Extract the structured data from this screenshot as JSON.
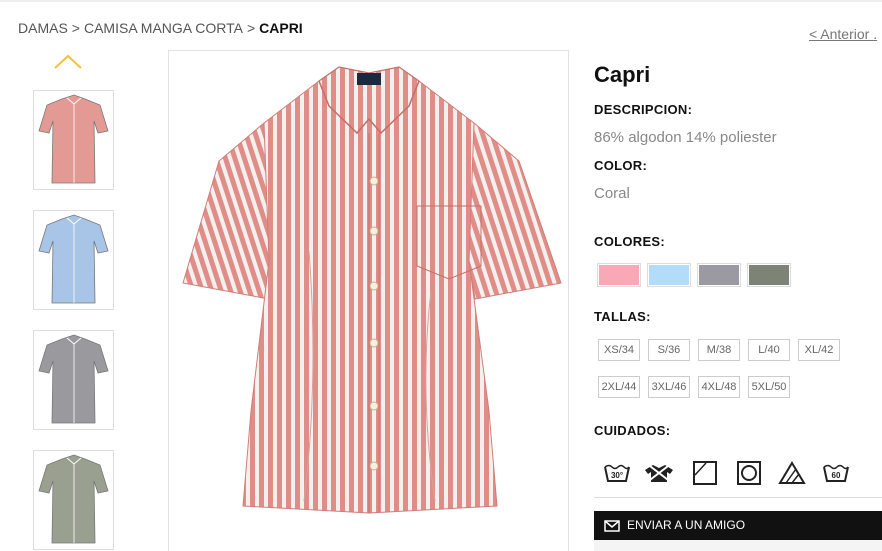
{
  "breadcrumb": {
    "items": [
      "DAMAS",
      "CAMISA MANGA CORTA"
    ],
    "separator": ">",
    "current": "CAPRI"
  },
  "nav": {
    "previous": "< Anterior ."
  },
  "thumbnails": [
    {
      "color": "#e49a94",
      "label": "coral"
    },
    {
      "color": "#a8c4e6",
      "label": "blue"
    },
    {
      "color": "#9a9a9e",
      "label": "grey"
    },
    {
      "color": "#9aa090",
      "label": "olive"
    }
  ],
  "product": {
    "name": "Capri",
    "description_label": "DESCRIPCION:",
    "description": "86% algodon 14% poliester",
    "color_label": "COLOR:",
    "color": "Coral",
    "colors_label": "COLORES:",
    "colors": [
      "#f8a9b5",
      "#b3dbfa",
      "#9b9aa3",
      "#7e8475"
    ],
    "sizes_label": "TALLAS:",
    "sizes": [
      "XS/34",
      "S/36",
      "M/38",
      "L/40",
      "XL/42",
      "2XL/44",
      "3XL/46",
      "4XL/48",
      "5XL/50"
    ],
    "care_label": "CUIDADOS:",
    "care_icons": [
      "wash-30-icon",
      "no-tumble-dry-icon",
      "line-dry-icon",
      "tumble-dry-icon",
      "no-bleach-icon",
      "wash-60-icon"
    ],
    "care_texts": {
      "wash30": "30°",
      "wash60": "60"
    }
  },
  "actions": {
    "send_friend": "ENVIAR A UN AMIGO"
  }
}
